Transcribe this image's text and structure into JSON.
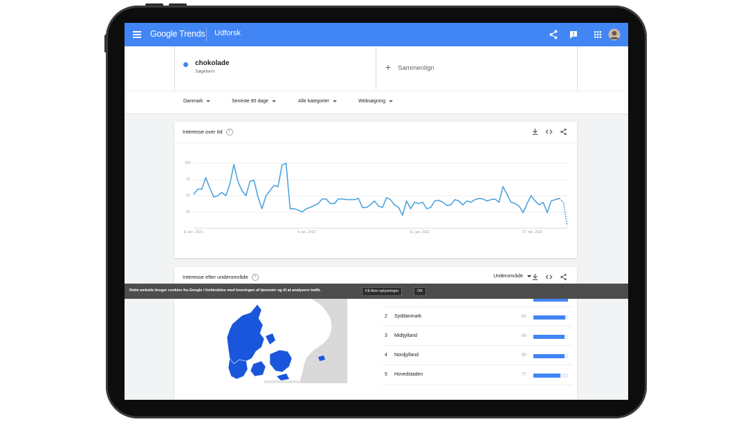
{
  "app": {
    "brand": "Google Trends",
    "section": "Udforsk",
    "colors": {
      "header": "#4285f4",
      "accent": "#4285f4",
      "series": "#4ea3dc"
    }
  },
  "search": {
    "term": "chokolade",
    "term_type": "Søgeterm",
    "compare_label": "Sammenlign",
    "compare_icon": "plus-icon"
  },
  "filters": [
    {
      "label": "Danmark"
    },
    {
      "label": "Seneste 90 dage"
    },
    {
      "label": "Alle kategorier"
    },
    {
      "label": "Websøgning"
    }
  ],
  "interest_over_time": {
    "title": "Interesse over tid",
    "icons": [
      "download-icon",
      "embed-icon",
      "share-icon"
    ]
  },
  "chart_data": {
    "type": "line",
    "title": "Interesse over tid",
    "ylim": [
      0,
      100
    ],
    "y_ticks": [
      "100",
      "75",
      "50",
      "25"
    ],
    "x_ticks": [
      "8. dec. 2021",
      "4. jan. 2022",
      "31. jan. 2022",
      "27. feb. 2022"
    ],
    "grid": true,
    "x": [
      "8. dec. 2021",
      "9. dec. 2021",
      "10. dec. 2021",
      "11. dec. 2021",
      "12. dec. 2021",
      "13. dec. 2021",
      "14. dec. 2021",
      "15. dec. 2021",
      "16. dec. 2021",
      "17. dec. 2021",
      "18. dec. 2021",
      "19. dec. 2021",
      "20. dec. 2021",
      "21. dec. 2021",
      "22. dec. 2021",
      "23. dec. 2021",
      "24. dec. 2021",
      "25. dec. 2021",
      "26. dec. 2021",
      "27. dec. 2021",
      "28. dec. 2021",
      "29. dec. 2021",
      "30. dec. 2021",
      "31. dec. 2021",
      "1. jan. 2022",
      "2. jan. 2022",
      "3. jan. 2022",
      "4. jan. 2022",
      "5. jan. 2022",
      "6. jan. 2022",
      "7. jan. 2022",
      "8. jan. 2022",
      "9. jan. 2022",
      "10. jan. 2022",
      "11. jan. 2022",
      "12. jan. 2022",
      "13. jan. 2022",
      "14. jan. 2022",
      "15. jan. 2022",
      "16. jan. 2022",
      "17. jan. 2022",
      "18. jan. 2022",
      "19. jan. 2022",
      "20. jan. 2022",
      "21. jan. 2022",
      "22. jan. 2022",
      "23. jan. 2022",
      "24. jan. 2022",
      "25. jan. 2022",
      "26. jan. 2022",
      "27. jan. 2022",
      "28. jan. 2022",
      "29. jan. 2022",
      "30. jan. 2022",
      "31. jan. 2022",
      "1. feb. 2022",
      "2. feb. 2022",
      "3. feb. 2022",
      "4. feb. 2022",
      "5. feb. 2022",
      "6. feb. 2022",
      "7. feb. 2022",
      "8. feb. 2022",
      "9. feb. 2022",
      "10. feb. 2022",
      "11. feb. 2022",
      "12. feb. 2022",
      "13. feb. 2022",
      "14. feb. 2022",
      "15. feb. 2022",
      "16. feb. 2022",
      "17. feb. 2022",
      "18. feb. 2022",
      "19. feb. 2022",
      "20. feb. 2022",
      "21. feb. 2022",
      "22. feb. 2022",
      "23. feb. 2022",
      "24. feb. 2022",
      "25. feb. 2022",
      "26. feb. 2022",
      "27. feb. 2022",
      "28. feb. 2022",
      "1. mar. 2022",
      "2. mar. 2022",
      "3. mar. 2022",
      "4. mar. 2022",
      "5. mar. 2022",
      "6. mar. 2022",
      "7. mar. 2022",
      "8. mar. 2022"
    ],
    "series": [
      {
        "values": [
          52,
          60,
          60,
          78,
          62,
          48,
          50,
          55,
          50,
          68,
          98,
          72,
          58,
          50,
          72,
          74,
          48,
          30,
          50,
          58,
          66,
          64,
          97,
          100,
          30,
          30,
          28,
          25,
          30,
          32,
          35,
          38,
          45,
          45,
          38,
          38,
          45,
          45,
          44,
          44,
          44,
          46,
          32,
          32,
          36,
          42,
          34,
          32,
          47,
          44,
          36,
          32,
          20,
          42,
          30,
          40,
          38,
          40,
          30,
          32,
          42,
          43,
          40,
          35,
          36,
          44,
          42,
          36,
          42,
          40,
          44,
          46,
          45,
          42,
          44,
          45,
          40,
          64,
          52,
          40,
          38,
          34,
          24,
          38,
          50,
          42,
          36,
          40,
          24,
          42,
          44,
          46,
          40,
          4
        ]
      }
    ]
  },
  "interest_by_region": {
    "title": "Interesse efter underområde",
    "region_selector": "Underområde",
    "icons": [
      "download-icon",
      "embed-icon",
      "share-icon"
    ],
    "rows": [
      {
        "rank": "2",
        "name": "Syddanmark",
        "value": "92",
        "pct": 0.92
      },
      {
        "rank": "3",
        "name": "Midtjylland",
        "value": "90",
        "pct": 0.9
      },
      {
        "rank": "4",
        "name": "Nordjylland",
        "value": "90",
        "pct": 0.9
      },
      {
        "rank": "5",
        "name": "Hovedstaden",
        "value": "77",
        "pct": 0.77
      }
    ]
  },
  "cookie_banner": {
    "text": "Dette website bruger cookies fra Google i forbindelse med leveringen af tjenester og til at analysere trafik.",
    "more_info_button": "Få flere oplysninger",
    "ok_button": "OK"
  }
}
